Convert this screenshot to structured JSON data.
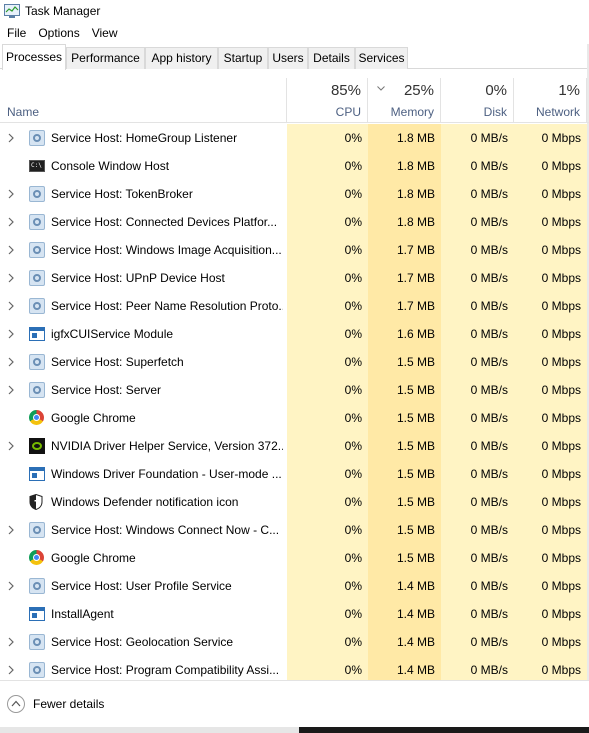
{
  "window": {
    "title": "Task Manager"
  },
  "menu": [
    "File",
    "Options",
    "View"
  ],
  "tabs": [
    {
      "label": "Processes",
      "active": true
    },
    {
      "label": "Performance",
      "active": false
    },
    {
      "label": "App history",
      "active": false
    },
    {
      "label": "Startup",
      "active": false
    },
    {
      "label": "Users",
      "active": false
    },
    {
      "label": "Details",
      "active": false
    },
    {
      "label": "Services",
      "active": false
    }
  ],
  "columns": {
    "name": {
      "label": "Name"
    },
    "cpu": {
      "label": "CPU",
      "percent": "85%"
    },
    "memory": {
      "label": "Memory",
      "percent": "25%"
    },
    "disk": {
      "label": "Disk",
      "percent": "0%"
    },
    "network": {
      "label": "Network",
      "percent": "1%"
    }
  },
  "colors": {
    "heat_light": "#fff4c4",
    "heat_medium": "#ffe9a6",
    "header_label": "#4d6082"
  },
  "processes": [
    {
      "name": "Service Host: HomeGroup Listener",
      "icon": "gear-icon",
      "expandable": true,
      "cpu": "0%",
      "memory": "1.8 MB",
      "disk": "0 MB/s",
      "network": "0 Mbps"
    },
    {
      "name": "Console Window Host",
      "icon": "console-icon",
      "expandable": false,
      "cpu": "0%",
      "memory": "1.8 MB",
      "disk": "0 MB/s",
      "network": "0 Mbps"
    },
    {
      "name": "Service Host: TokenBroker",
      "icon": "gear-icon",
      "expandable": true,
      "cpu": "0%",
      "memory": "1.8 MB",
      "disk": "0 MB/s",
      "network": "0 Mbps"
    },
    {
      "name": "Service Host: Connected Devices Platfor...",
      "icon": "gear-icon",
      "expandable": true,
      "cpu": "0%",
      "memory": "1.8 MB",
      "disk": "0 MB/s",
      "network": "0 Mbps"
    },
    {
      "name": "Service Host: Windows Image Acquisition...",
      "icon": "gear-icon",
      "expandable": true,
      "cpu": "0%",
      "memory": "1.7 MB",
      "disk": "0 MB/s",
      "network": "0 Mbps"
    },
    {
      "name": "Service Host: UPnP Device Host",
      "icon": "gear-icon",
      "expandable": true,
      "cpu": "0%",
      "memory": "1.7 MB",
      "disk": "0 MB/s",
      "network": "0 Mbps"
    },
    {
      "name": "Service Host: Peer Name Resolution Proto...",
      "icon": "gear-icon",
      "expandable": true,
      "cpu": "0%",
      "memory": "1.7 MB",
      "disk": "0 MB/s",
      "network": "0 Mbps"
    },
    {
      "name": "igfxCUIService Module",
      "icon": "window-app-icon",
      "expandable": true,
      "cpu": "0%",
      "memory": "1.6 MB",
      "disk": "0 MB/s",
      "network": "0 Mbps"
    },
    {
      "name": "Service Host: Superfetch",
      "icon": "gear-icon",
      "expandable": true,
      "cpu": "0%",
      "memory": "1.5 MB",
      "disk": "0 MB/s",
      "network": "0 Mbps"
    },
    {
      "name": "Service Host: Server",
      "icon": "gear-icon",
      "expandable": true,
      "cpu": "0%",
      "memory": "1.5 MB",
      "disk": "0 MB/s",
      "network": "0 Mbps"
    },
    {
      "name": "Google Chrome",
      "icon": "chrome-icon",
      "expandable": false,
      "cpu": "0%",
      "memory": "1.5 MB",
      "disk": "0 MB/s",
      "network": "0 Mbps"
    },
    {
      "name": "NVIDIA Driver Helper Service, Version 372....",
      "icon": "nvidia-icon",
      "expandable": true,
      "cpu": "0%",
      "memory": "1.5 MB",
      "disk": "0 MB/s",
      "network": "0 Mbps"
    },
    {
      "name": "Windows Driver Foundation - User-mode ...",
      "icon": "window-app-icon",
      "expandable": false,
      "cpu": "0%",
      "memory": "1.5 MB",
      "disk": "0 MB/s",
      "network": "0 Mbps"
    },
    {
      "name": "Windows Defender notification icon",
      "icon": "shield-icon",
      "expandable": false,
      "cpu": "0%",
      "memory": "1.5 MB",
      "disk": "0 MB/s",
      "network": "0 Mbps"
    },
    {
      "name": "Service Host: Windows Connect Now - C...",
      "icon": "gear-icon",
      "expandable": true,
      "cpu": "0%",
      "memory": "1.5 MB",
      "disk": "0 MB/s",
      "network": "0 Mbps"
    },
    {
      "name": "Google Chrome",
      "icon": "chrome-icon",
      "expandable": false,
      "cpu": "0%",
      "memory": "1.5 MB",
      "disk": "0 MB/s",
      "network": "0 Mbps"
    },
    {
      "name": "Service Host: User Profile Service",
      "icon": "gear-icon",
      "expandable": true,
      "cpu": "0%",
      "memory": "1.4 MB",
      "disk": "0 MB/s",
      "network": "0 Mbps"
    },
    {
      "name": "InstallAgent",
      "icon": "window-app-icon",
      "expandable": false,
      "cpu": "0%",
      "memory": "1.4 MB",
      "disk": "0 MB/s",
      "network": "0 Mbps"
    },
    {
      "name": "Service Host: Geolocation Service",
      "icon": "gear-icon",
      "expandable": true,
      "cpu": "0%",
      "memory": "1.4 MB",
      "disk": "0 MB/s",
      "network": "0 Mbps"
    },
    {
      "name": "Service Host: Program Compatibility Assi...",
      "icon": "gear-icon",
      "expandable": true,
      "cpu": "0%",
      "memory": "1.4 MB",
      "disk": "0 MB/s",
      "network": "0 Mbps"
    }
  ],
  "footer": {
    "fewer_details_label": "Fewer details"
  }
}
